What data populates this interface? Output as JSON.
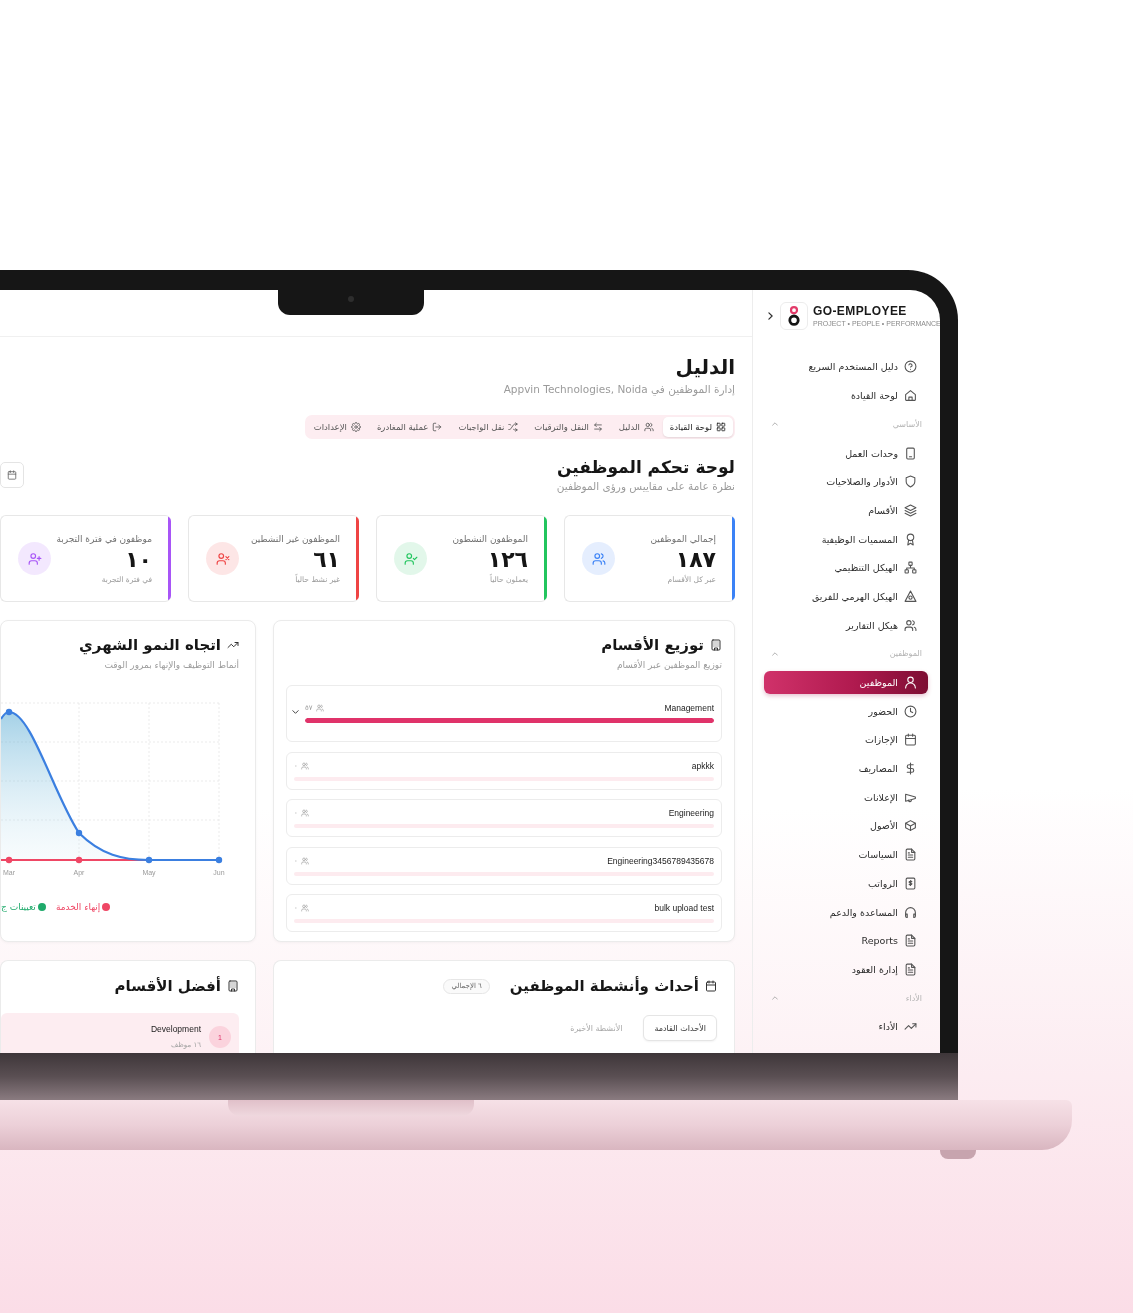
{
  "sidebar": {
    "brand_name": "GO-EMPLOYEE",
    "brand_tagline": "PROJECT • PEOPLE • PERFORMANCE",
    "items": [
      {
        "label": "دليل المستخدم السريع",
        "selected": false
      },
      {
        "label": "لوحة القيادة",
        "selected": false
      }
    ],
    "sections": [
      {
        "title": "الأساسي",
        "expanded": true,
        "items": [
          {
            "label": "وحدات العمل",
            "selected": false
          },
          {
            "label": "الأدوار والصلاحيات",
            "selected": false
          },
          {
            "label": "الأقسام",
            "selected": false
          },
          {
            "label": "المسميات الوظيفية",
            "selected": false
          },
          {
            "label": "الهيكل التنظيمي",
            "selected": false
          },
          {
            "label": "الهيكل الهرمي للفريق",
            "selected": false
          },
          {
            "label": "هيكل التقارير",
            "selected": false
          }
        ]
      },
      {
        "title": "الموظفين",
        "expanded": true,
        "items": [
          {
            "label": "الموظفين",
            "selected": true
          },
          {
            "label": "الحضور",
            "selected": false
          },
          {
            "label": "الإجازات",
            "selected": false
          },
          {
            "label": "المصاريف",
            "selected": false
          },
          {
            "label": "الإعلانات",
            "selected": false
          },
          {
            "label": "الأصول",
            "selected": false
          },
          {
            "label": "السياسات",
            "selected": false
          },
          {
            "label": "الرواتب",
            "selected": false
          },
          {
            "label": "المساعدة والدعم",
            "selected": false
          },
          {
            "label": "Reports",
            "selected": false
          },
          {
            "label": "إدارة العقود",
            "selected": false
          }
        ]
      },
      {
        "title": "الأداء",
        "expanded": true,
        "items": [
          {
            "label": "الأداء",
            "selected": false
          }
        ]
      }
    ]
  },
  "page": {
    "title": "الدليل",
    "subtitle": "إدارة الموظفين في Appvin Technologies, Noida"
  },
  "tabs": [
    {
      "label": "لوحة القيادة",
      "selected": true
    },
    {
      "label": "الدليل",
      "selected": false
    },
    {
      "label": "النقل والترقيات",
      "selected": false
    },
    {
      "label": "نقل الواجبات",
      "selected": false
    },
    {
      "label": "عملية المغادرة",
      "selected": false
    },
    {
      "label": "الإعدادات",
      "selected": false
    }
  ],
  "dashboard": {
    "title": "لوحة تحكم الموظفين",
    "subtitle": "نظرة عامة على مقاييس ورؤى الموظفين"
  },
  "stat_cards": [
    {
      "label": "إجمالي الموظفين",
      "value": "١٨٧",
      "note": "عبر كل الأقسام",
      "color": "#3b82f6"
    },
    {
      "label": "الموظفون النشطون",
      "value": "١٢٦",
      "note": "يعملون حالياً",
      "color": "#22c55e"
    },
    {
      "label": "الموظفون غير النشطين",
      "value": "٦١",
      "note": "غير نشط حالياً",
      "color": "#ef4444"
    },
    {
      "label": "موظفون في فترة التجربة",
      "value": "١٠",
      "note": "في فترة التجربة",
      "color": "#a855f7"
    }
  ],
  "department_distribution": {
    "title": "توزيع الأقسام",
    "subtitle": "توزيع الموظفين عبر الأقسام",
    "rows": [
      {
        "name": "Management",
        "count": "٥٧",
        "level": 1,
        "expandable": true
      },
      {
        "name": "apkkk",
        "count": "٠",
        "level": 0,
        "expandable": false
      },
      {
        "name": "Engineering",
        "count": "٠",
        "level": 0,
        "expandable": false
      },
      {
        "name": "Engineering3456789435678",
        "count": "٠",
        "level": 0,
        "expandable": false
      },
      {
        "name": "bulk upload test",
        "count": "٠",
        "level": 0,
        "expandable": false
      }
    ]
  },
  "growth_chart": {
    "title": "اتجاه النمو الشهري",
    "subtitle": "أنماط التوظيف والإنهاء بمرور الوقت",
    "x_labels": [
      "Jun",
      "May",
      "Apr",
      "Mar"
    ],
    "legend": [
      {
        "label": "إنهاء الخدمة",
        "color": "#ef4765"
      },
      {
        "label": "تعيينات ج",
        "color": "#1faa6b"
      }
    ]
  },
  "events": {
    "title": "أحداث وأنشطة الموظفين",
    "badge": "٦ الإجمالي",
    "tabs": [
      {
        "label": "الأحداث القادمة",
        "selected": true
      },
      {
        "label": "الأنشطة الأخيرة",
        "selected": false
      }
    ]
  },
  "top_departments": {
    "title": "أفضل الأقسام",
    "rows": [
      {
        "rank": "1",
        "name": "Development",
        "count": "١٦ موظف"
      }
    ]
  }
}
